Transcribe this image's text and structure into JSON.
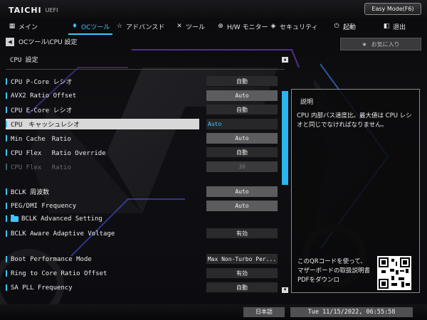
{
  "brand": {
    "logo": "TAICHI",
    "suffix": "UEFI"
  },
  "easy_mode": "Easy Mode(F6)",
  "nav": [
    {
      "label": "メイン",
      "icon": "grid-icon"
    },
    {
      "label": "OCツール",
      "icon": "flame-icon"
    },
    {
      "label": "アドバンスド",
      "icon": "star-icon"
    },
    {
      "label": "ツール",
      "icon": "tools-icon"
    },
    {
      "label": "H/W モニター",
      "icon": "monitor-icon"
    },
    {
      "label": "セキュリティ",
      "icon": "shield-icon"
    },
    {
      "label": "起動",
      "icon": "power-icon"
    },
    {
      "label": "退出",
      "icon": "exit-icon"
    }
  ],
  "breadcrumb": "OCツール\\CPU 設定",
  "favorite": "お気に入り",
  "section_title": "CPU 設定",
  "settings": [
    {
      "label": "CPU P-Core レシオ",
      "value": "自動"
    },
    {
      "label": "AVX2 Ratio Offset",
      "value": "Auto"
    },
    {
      "label": "CPU E-Core レシオ",
      "value": "自動"
    },
    {
      "label": "CPU　キャッシュレシオ",
      "value": "Auto"
    },
    {
      "label": "Min Cache　Ratio",
      "value": "Auto"
    },
    {
      "label": "CPU Flex　 Ratio Override",
      "value": "自動"
    },
    {
      "label": "CPU Flex　 Ratio",
      "value": "30"
    },
    {
      "label": "BCLK 周波数",
      "value": "Auto"
    },
    {
      "label": "PEG/DMI Frequency",
      "value": "Auto"
    },
    {
      "label": "BCLK Advanced Setting",
      "value": ""
    },
    {
      "label": "BCLK Aware Adaptive Voltage",
      "value": "有効"
    },
    {
      "label": "Boot Performance Mode",
      "value": "Max Non-Turbo Per..."
    },
    {
      "label": "Ring to Core Ratio Offset",
      "value": "有効"
    },
    {
      "label": "SA PLL Frequency",
      "value": "自動"
    }
  ],
  "description": {
    "title": "説明",
    "text": "CPU 内部バス速度比。最大値は CPU レシオと同じでなければなりません。",
    "qr_text": "このQRコードを使って、マザーボードの取扱説明書PDFをダウンロ"
  },
  "footer": {
    "language": "日本語",
    "datetime": "Tue 11/15/2022, 06:55:58"
  },
  "colors": {
    "accent": "#3fc6ff",
    "highlight_row": "#d8d8d8"
  }
}
